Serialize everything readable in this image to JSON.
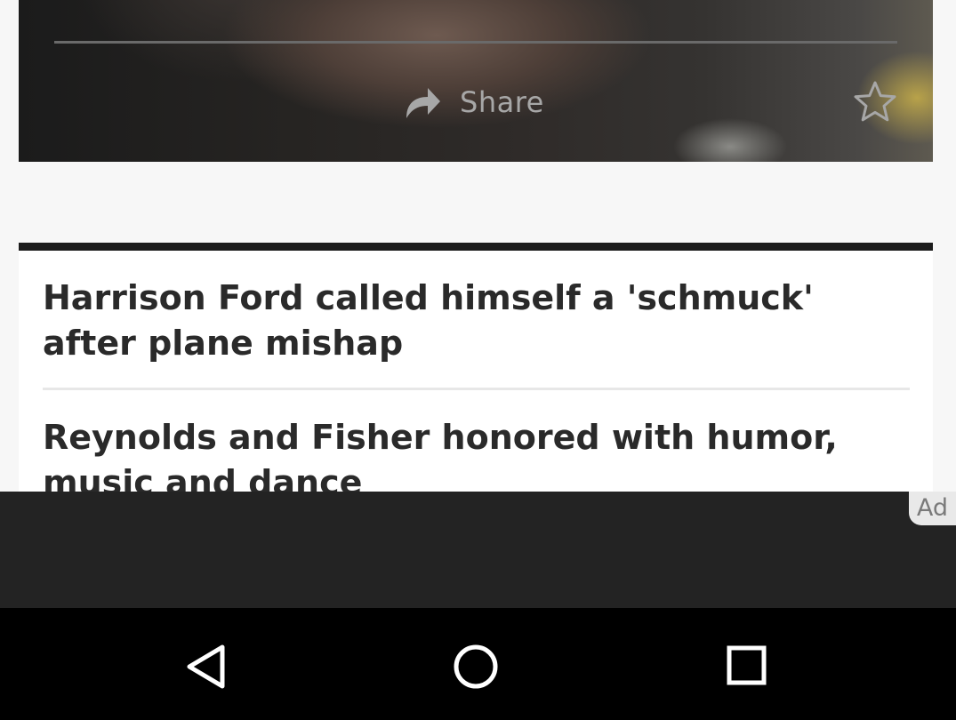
{
  "hero": {
    "share_label": "Share",
    "icons": [
      "share-arrow-icon",
      "star-outline-icon"
    ]
  },
  "related": {
    "items": [
      {
        "title": "Harrison Ford called himself a 'schmuck' after plane mishap"
      },
      {
        "title": "Reynolds and Fisher honored with humor, music and dance"
      }
    ]
  },
  "ad": {
    "badge_label": "Ad"
  },
  "navbar": {
    "buttons": [
      "back-icon",
      "home-icon",
      "recents-icon"
    ]
  },
  "colors": {
    "page_background": "#f7f7f7",
    "headline_text": "#2a2a2a",
    "list_top_border": "#1c1c1c",
    "ad_band": "#232323",
    "nav_bar": "#000000",
    "share_text": "#a7a7a7"
  }
}
